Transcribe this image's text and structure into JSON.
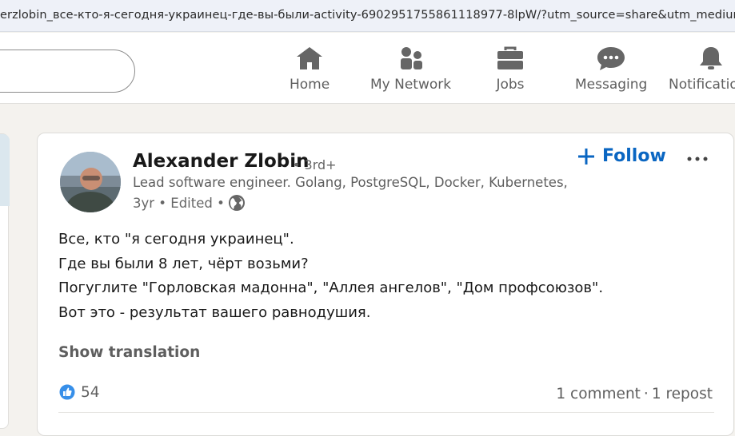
{
  "browser": {
    "url": "erzlobin_все-кто-я-сегодня-украинец-где-вы-были-activity-6902951755861118977-8lpW/?utm_source=share&utm_medium=member_desktop"
  },
  "nav": {
    "items": [
      {
        "label": "Home",
        "icon": "home-icon"
      },
      {
        "label": "My Network",
        "icon": "network-icon"
      },
      {
        "label": "Jobs",
        "icon": "briefcase-icon"
      },
      {
        "label": "Messaging",
        "icon": "messaging-icon"
      },
      {
        "label": "Notifications",
        "icon": "bell-icon"
      }
    ]
  },
  "post": {
    "author": {
      "name": "Alexander Zlobin",
      "degree": "• 3rd+",
      "headline": "Lead software engineer. Golang, PostgreSQL, Docker, Kubernetes, AWS",
      "meta": "3yr • Edited •"
    },
    "follow_label": "Follow",
    "lines": [
      "Все, кто \"я сегодня украинец\".",
      "Где вы были 8 лет, чёрт возьми?",
      "Погуглите \"Горловская мадонна\", \"Аллея ангелов\", \"Дом профсоюзов\".",
      "Вот это - результат вашего равнодушия."
    ],
    "show_translation": "Show translation",
    "reaction_count": "54",
    "comments": "1 comment",
    "separator": "·",
    "reposts": "1 repost"
  },
  "colors": {
    "accent": "#0a66c2",
    "muted_text": "#5e5e5e",
    "page_bg": "#f4f2ee"
  }
}
